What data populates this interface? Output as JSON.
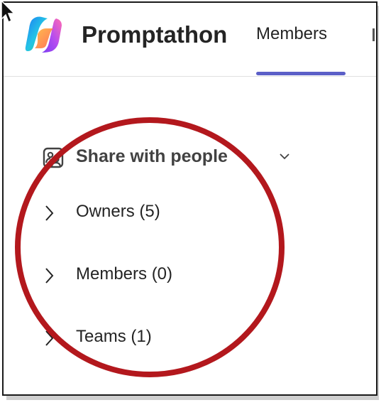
{
  "header": {
    "app_title": "Promptathon",
    "active_tab": "Members"
  },
  "sharing": {
    "section_label": "Share with people",
    "groups": [
      {
        "label": "Owners (5)"
      },
      {
        "label": "Members (0)"
      },
      {
        "label": "Teams (1)"
      }
    ]
  },
  "colors": {
    "tab_underline": "#5b5fc7",
    "annotation_circle": "#b3181d"
  },
  "icons": {
    "logo": "copilot-logo",
    "share": "people-share-icon",
    "collapse": "chevron-down-icon",
    "expand": "chevron-right-icon",
    "pointer": "mouse-cursor-icon"
  }
}
